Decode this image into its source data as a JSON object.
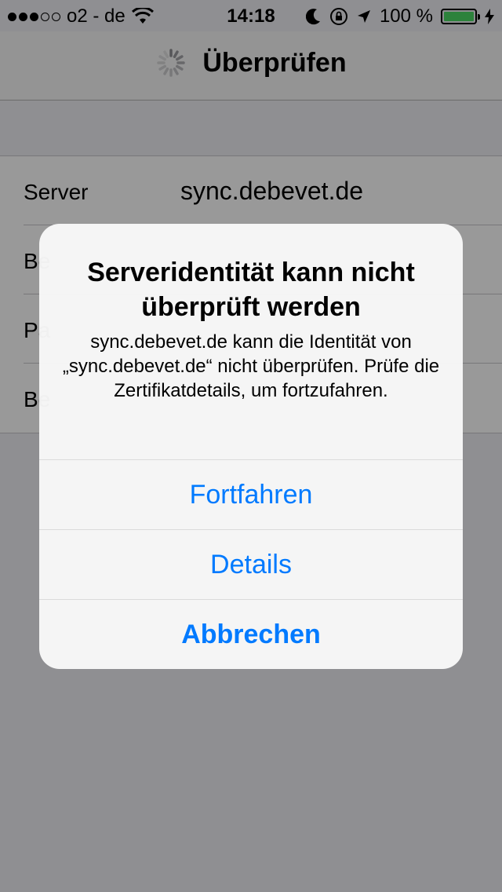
{
  "status_bar": {
    "carrier": "o2 - de",
    "time": "14:18",
    "battery": "100 %",
    "signal_bars_filled": 3,
    "signal_bars_total": 5,
    "battery_level": 1.0,
    "icons": [
      "wifi-icon",
      "moon-icon",
      "rotation-lock-icon",
      "location-arrow-icon",
      "battery-icon",
      "charging-bolt-icon"
    ]
  },
  "nav": {
    "title": "Überprüfen",
    "activity_indicator": "spinner-icon"
  },
  "form": {
    "rows": [
      {
        "label": "Server",
        "value": "sync.debevet.de"
      },
      {
        "label": "Be",
        "value": ""
      },
      {
        "label": "Pa",
        "value": ""
      },
      {
        "label": "Be",
        "value": ""
      }
    ]
  },
  "alert": {
    "title": "Serveridentität kann nicht überprüft werden",
    "message": "sync.debevet.de kann die Identität von „sync.debevet.de“ nicht überprüfen. Prüfe die Zertifikatdetails, um fortzufahren.",
    "buttons": {
      "continue": "Fortfahren",
      "details": "Details",
      "cancel": "Abbrechen"
    }
  },
  "colors": {
    "accent": "#007aff",
    "battery": "#4cd964",
    "dim": "rgba(0,0,0,0.4)"
  }
}
